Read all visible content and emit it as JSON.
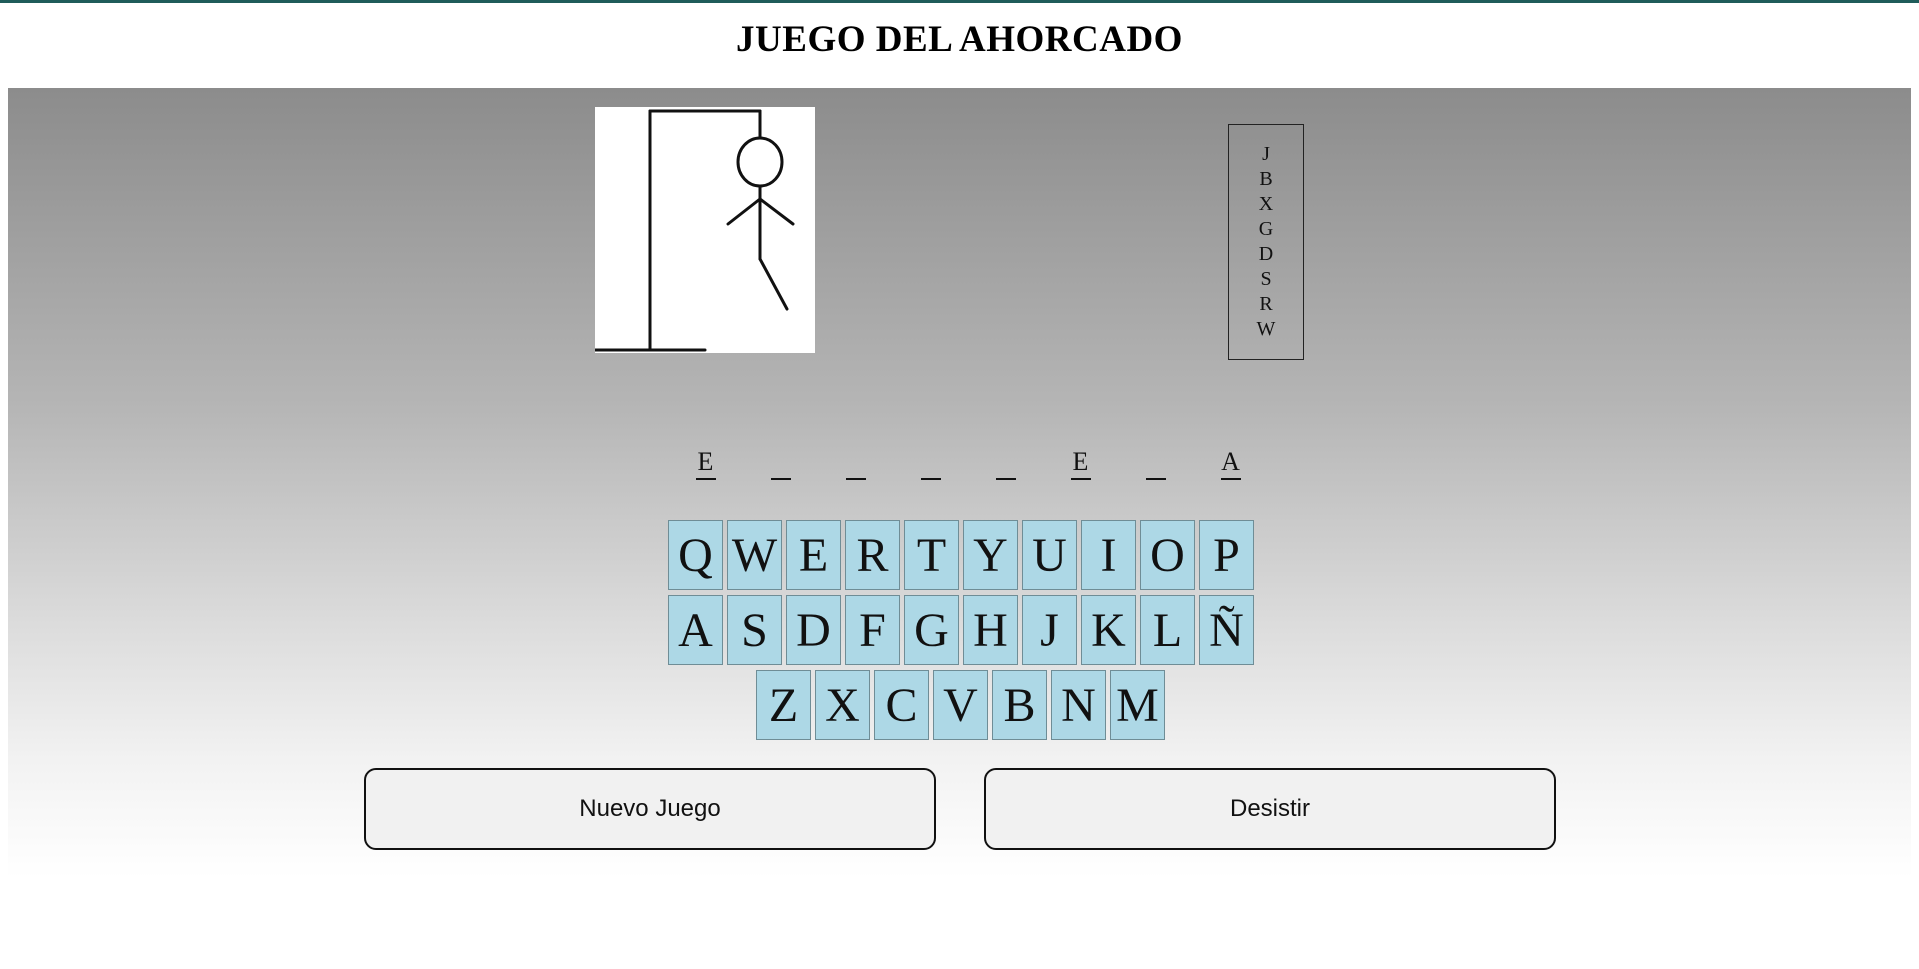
{
  "page": {
    "title": "JUEGO DEL AHORCADO"
  },
  "used_letters": [
    "J",
    "B",
    "X",
    "G",
    "D",
    "S",
    "R",
    "W"
  ],
  "word": [
    "E",
    "_",
    "_",
    "_",
    "_",
    "E",
    "_",
    "A"
  ],
  "keyboard": [
    [
      "Q",
      "W",
      "E",
      "R",
      "T",
      "Y",
      "U",
      "I",
      "O",
      "P"
    ],
    [
      "A",
      "S",
      "D",
      "F",
      "G",
      "H",
      "J",
      "K",
      "L",
      "Ñ"
    ],
    [
      "Z",
      "X",
      "C",
      "V",
      "B",
      "N",
      "M"
    ]
  ],
  "buttons": {
    "new_game": "Nuevo Juego",
    "give_up": "Desistir"
  },
  "colors": {
    "key_bg": "#add8e6",
    "top_border": "#1f5c5a"
  }
}
